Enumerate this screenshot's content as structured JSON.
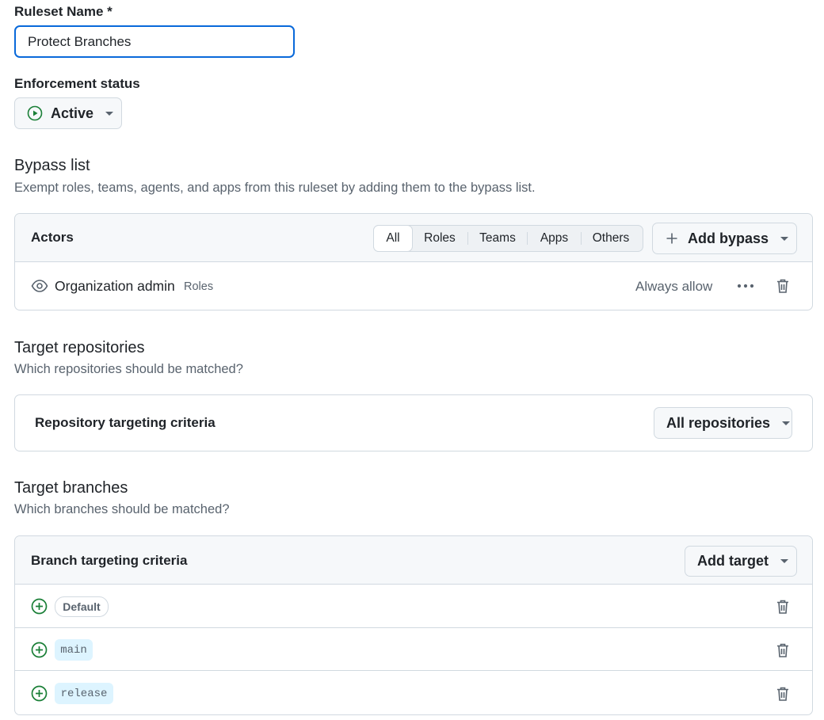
{
  "ruleset": {
    "name_label": "Ruleset Name *",
    "name_value": "Protect Branches"
  },
  "enforcement": {
    "label": "Enforcement status",
    "value": "Active",
    "icon": "play-circle-icon",
    "icon_color": "#1a7f37"
  },
  "bypass": {
    "title": "Bypass list",
    "description": "Exempt roles, teams, agents, and apps from this ruleset by adding them to the bypass list.",
    "header_label": "Actors",
    "filters": [
      "All",
      "Roles",
      "Teams",
      "Apps",
      "Others"
    ],
    "selected_filter": "All",
    "add_button": "Add bypass",
    "actors": [
      {
        "name": "Organization admin",
        "type": "Roles",
        "mode": "Always allow",
        "icon": "eye-icon"
      }
    ]
  },
  "repositories": {
    "title": "Target repositories",
    "description": "Which repositories should be matched?",
    "criteria_label": "Repository targeting criteria",
    "dropdown_value": "All repositories"
  },
  "branches": {
    "title": "Target branches",
    "description": "Which branches should be matched?",
    "criteria_label": "Branch targeting criteria",
    "add_button": "Add target",
    "targets": [
      {
        "label": "Default",
        "kind": "default"
      },
      {
        "label": "main",
        "kind": "code"
      },
      {
        "label": "release",
        "kind": "code"
      }
    ]
  },
  "colors": {
    "accent": "#0969da",
    "success": "#1a7f37",
    "border": "#d1d9e0",
    "muted": "#59636e"
  }
}
